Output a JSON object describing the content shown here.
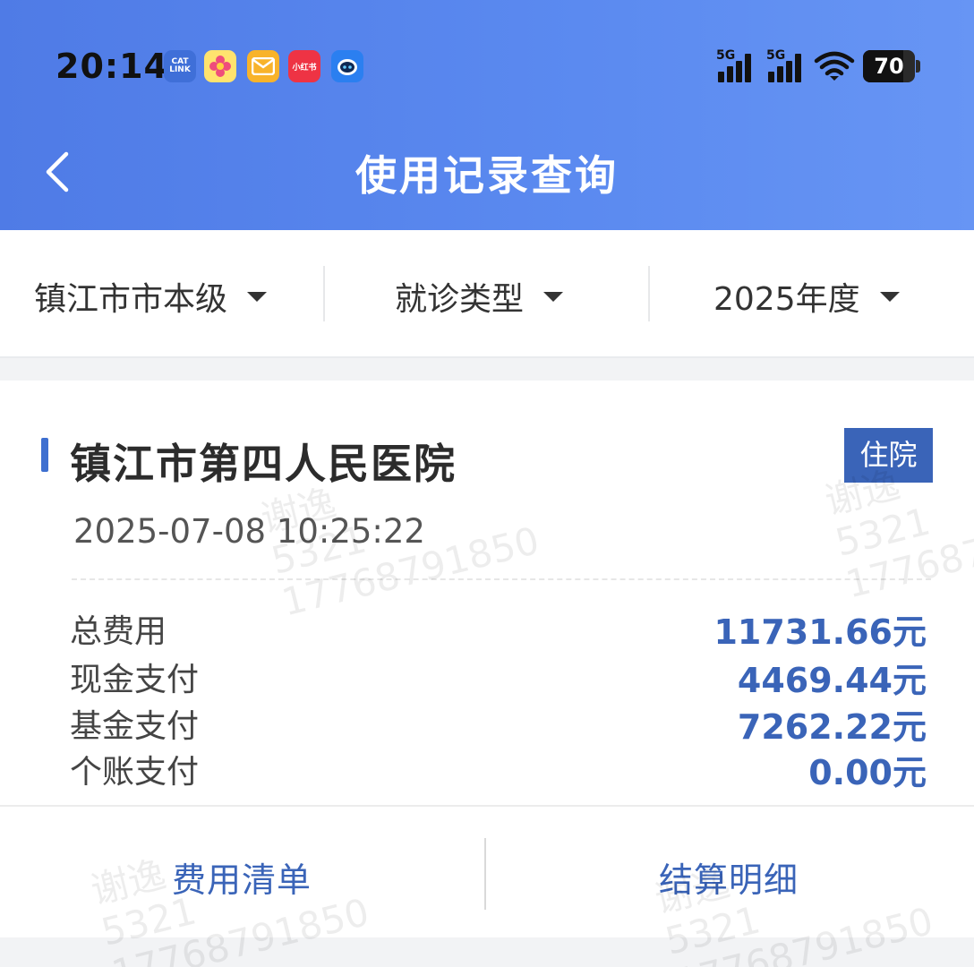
{
  "status_bar": {
    "time": "20:14",
    "app_icons": [
      "cat-link-icon",
      "flower-app-icon",
      "mail-icon",
      "xiaohongshu-icon",
      "robot-app-icon"
    ],
    "cat_icon_text": "CAT\nLINK",
    "red_app_text": "小红书",
    "signal_1_label": "5G",
    "signal_2_label": "5G",
    "battery_level": "70"
  },
  "header": {
    "title": "使用记录查询",
    "background_color": "#5585ec"
  },
  "filters": [
    {
      "label": "镇江市市本级"
    },
    {
      "label": "就诊类型"
    },
    {
      "label": "2025年度"
    }
  ],
  "record": {
    "hospital_name": "镇江市第四人民医院",
    "type_badge": "住院",
    "datetime": "2025-07-08 10:25:22",
    "rows": [
      {
        "label": "总费用",
        "value": "11731.66元"
      },
      {
        "label": "现金支付",
        "value": "4469.44元"
      },
      {
        "label": "基金支付",
        "value": "7262.22元"
      },
      {
        "label": "个账支付",
        "value": "0.00元"
      }
    ],
    "actions": [
      {
        "label": "费用清单"
      },
      {
        "label": "结算明细"
      }
    ],
    "accent_color": "#3a64b8"
  },
  "watermark": {
    "name": "谢逸",
    "code": "5321",
    "phone": "17768791850"
  }
}
